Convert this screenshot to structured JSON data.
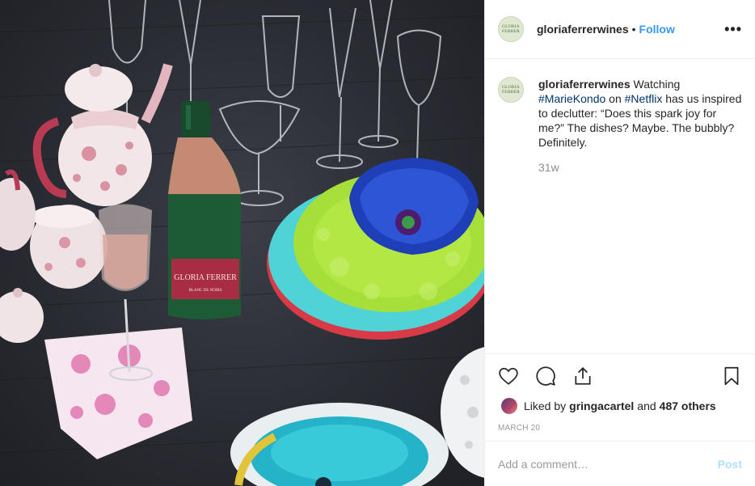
{
  "photo": {
    "alt_icon": "photo-table-setting",
    "bottle_label": "GLORIA FERRER",
    "bottle_sublabel": "BLANC DE NOIRS"
  },
  "header": {
    "avatar_line1": "GLORIA",
    "avatar_line2": "FERRER",
    "username": "gloriaferrerwines",
    "separator": "•",
    "follow_label": "Follow",
    "more_label": "•••"
  },
  "caption": {
    "username": "gloriaferrerwines",
    "text_1": " Watching ",
    "tag_1": "#MarieKondo",
    "text_2": " on ",
    "tag_2": "#Netflix",
    "text_3": " has us inspired to declutter: “Does this spark joy for me?” The dishes? Maybe. The bubbly? Definitely.",
    "time": "31w"
  },
  "likes": {
    "prefix": "Liked by",
    "user": "gringacartel",
    "conj": "and",
    "others": "487 others"
  },
  "date": "MARCH 20",
  "comment_box": {
    "placeholder": "Add a comment…",
    "post_label": "Post"
  },
  "colors": {
    "link": "#003569",
    "follow": "#3897f0",
    "post_disabled": "#b2dffc",
    "muted": "#8e8e8e"
  }
}
